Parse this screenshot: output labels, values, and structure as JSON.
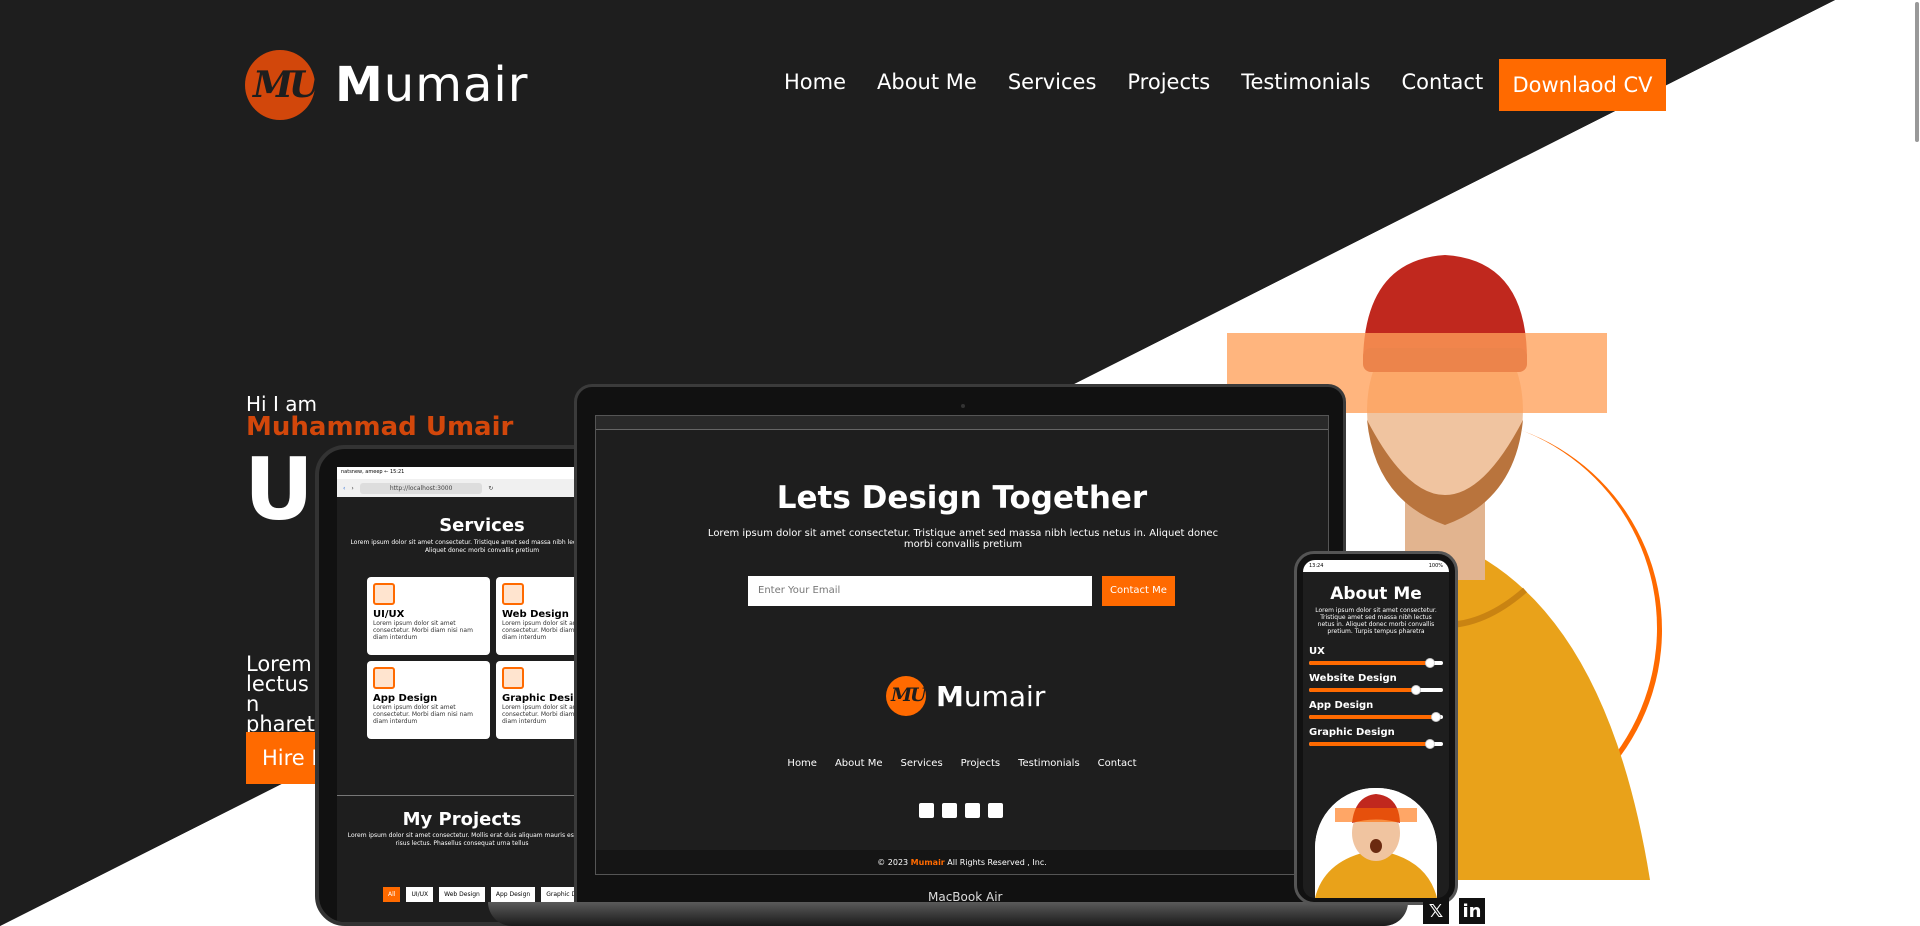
{
  "header": {
    "logo_text": "Mumair",
    "logo_mark": "MU",
    "nav": [
      "Home",
      "About Me",
      "Services",
      "Projects",
      "Testimonials",
      "Contact"
    ],
    "cv_button": "Downlaod CV"
  },
  "hero": {
    "greeting": "Hi I am",
    "name": "Muhammad Umair",
    "role_partial": "UI",
    "para_line1": "Lorem i",
    "para_line2": "lectus n",
    "para_line3": "pharetr",
    "hire_button": "Hire Me"
  },
  "tablet": {
    "status": "natsnew, ameep ← 15:21",
    "url": "http://localhost:3000",
    "services_title": "Services",
    "services_sub": "Lorem ipsum dolor sit amet consectetur. Tristique amet sed massa nibh lectus netus in. Aliquet donec morbi convallis pretium",
    "cards": [
      {
        "title": "UI/UX",
        "desc": "Lorem ipsum dolor sit amet consectetur. Morbi diam nisi nam diam interdum"
      },
      {
        "title": "Web Design",
        "desc": "Lorem ipsum dolor sit amet consectetur. Morbi diam nisi nam diam interdum"
      },
      {
        "title": "App Design",
        "desc": "Lorem ipsum dolor sit amet consectetur. Morbi diam nisi nam diam interdum"
      },
      {
        "title": "Graphic Design",
        "desc": "Lorem ipsum dolor sit amet consectetur. Morbi diam nisi nam diam interdum"
      }
    ],
    "projects_title": "My Projects",
    "projects_sub": "Lorem ipsum dolor sit amet consectetur. Mollis erat duis aliquam mauris est risus lectus. Phasellus consequat urna tellus",
    "project_tabs": [
      "All",
      "UI/UX",
      "Web Design",
      "App Design",
      "Graphic De"
    ]
  },
  "laptop": {
    "title": "Lets Design Together",
    "subtitle": "Lorem ipsum dolor sit amet consectetur. Tristique amet sed massa nibh lectus netus in. Aliquet donec morbi convallis pretium",
    "email_placeholder": "Enter Your Email",
    "contact_button": "Contact Me",
    "logo_text": "Mumair",
    "logo_mark": "MU",
    "nav": [
      "Home",
      "About Me",
      "Services",
      "Projects",
      "Testimonials",
      "Contact"
    ],
    "footer_pre": "© 2023 ",
    "footer_brand": "Mumair",
    "footer_post": " All Rights Reserved , Inc.",
    "brand_label": "MacBook Air"
  },
  "phone": {
    "time": "13:24",
    "battery": "100%",
    "title": "About Me",
    "subtitle": "Lorem ipsum dolor sit amet consectetur. Tristique amet sed massa nibh lectus netus in. Aliquet donec morbi convallis pretium. Turpis tempus pharetra",
    "skills": [
      {
        "name": "UX",
        "level": 0.9
      },
      {
        "name": "Website Design",
        "level": 0.8
      },
      {
        "name": "App Design",
        "level": 0.95
      },
      {
        "name": "Graphic Design",
        "level": 0.9
      }
    ]
  },
  "colors": {
    "accent": "#ff6a00",
    "accent_dark": "#d2470b",
    "dark_bg": "#1e1e1e"
  },
  "bottom_social": [
    "twitter-icon",
    "linkedin-icon"
  ]
}
